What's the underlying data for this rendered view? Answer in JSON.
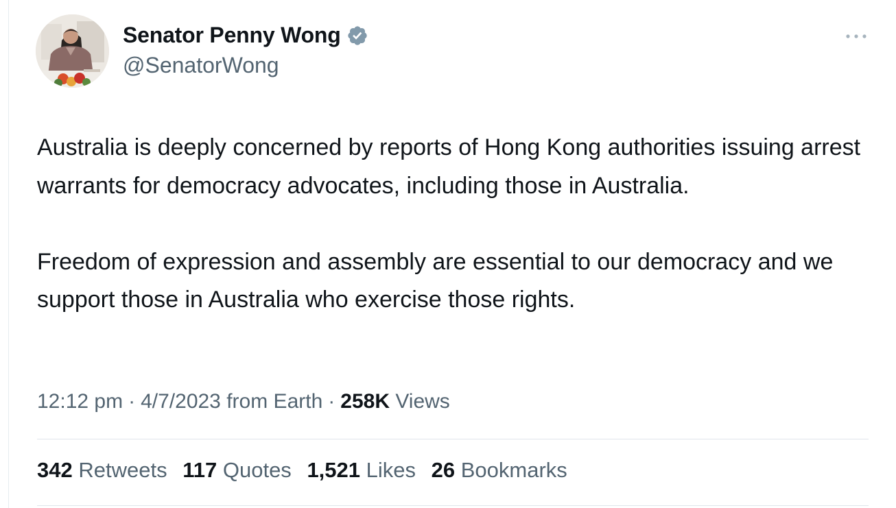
{
  "author": {
    "name": "Senator Penny Wong",
    "handle": "@SenatorWong",
    "verified_icon": "verified-badge-icon"
  },
  "more_icon": "more-options-icon",
  "tweet": {
    "paragraphs": [
      "Australia is deeply concerned by reports of Hong Kong authorities issuing arrest warrants for democracy advocates, including those in Australia.",
      "Freedom of expression and assembly are essential to our democracy and we support those in Australia who exercise those rights."
    ]
  },
  "meta": {
    "time": "12:12 pm",
    "separator": "·",
    "date": "4/7/2023",
    "source": "from Earth",
    "views_count": "258K",
    "views_label": "Views"
  },
  "stats": {
    "retweets": {
      "count": "342",
      "label": "Retweets"
    },
    "quotes": {
      "count": "117",
      "label": "Quotes"
    },
    "likes": {
      "count": "1,521",
      "label": "Likes"
    },
    "bookmarks": {
      "count": "26",
      "label": "Bookmarks"
    }
  },
  "colors": {
    "text_primary": "#0f1419",
    "text_secondary": "#536471",
    "verified_badge": "#829aab",
    "divider": "#dfe5ea"
  }
}
